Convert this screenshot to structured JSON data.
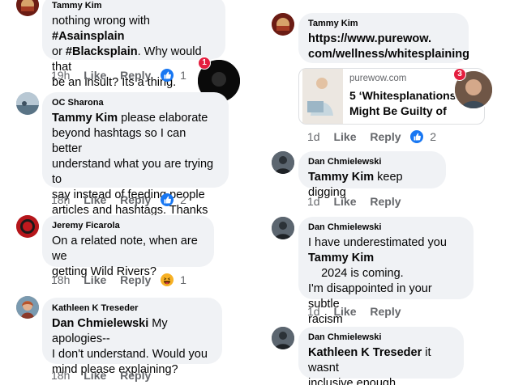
{
  "comments": {
    "c1": {
      "name": "Tammy Kim",
      "line1a": "nothing wrong with ",
      "line1b": "#Asainsplain",
      "line2a": "or ",
      "line2b": "#Blacksplain",
      "line2c": ". Why would that",
      "line3": "be an insult? Its a thing.",
      "time": "19h",
      "like": "Like",
      "reply": "Reply",
      "reaction_count": "1",
      "badge": "1"
    },
    "c2": {
      "name": "OC Sharona",
      "mention": "Tammy Kim",
      "line1": " please elaborate",
      "line2": "beyond hashtags so I can better",
      "line3": "understand what you are trying to",
      "line4": "say instead of feeding people",
      "line5": "articles and hashtags. Thanks",
      "time": "18h",
      "like": "Like",
      "reply": "Reply",
      "reaction_count": "2"
    },
    "c3": {
      "name": "Jeremy Ficarola",
      "line1": "On a related note, when are we",
      "line2": "getting Wild Rivers?",
      "time": "18h",
      "like": "Like",
      "reply": "Reply",
      "reaction_count": "1"
    },
    "c4": {
      "name": "Kathleen K Treseder",
      "mention": "Dan Chmielewski",
      "line1": " My apologies--",
      "line2": "I don't understand. Would you",
      "line3": "mind please explaining?",
      "time": "18h",
      "like": "Like",
      "reply": "Reply"
    },
    "c5": {
      "name": "Tammy Kim",
      "line1": "https://www.purewow.",
      "line2": "com/wellness/whitesplaining",
      "link_domain": "purewow.com",
      "link_title1": "5 ‘Whitesplanations",
      "link_title2": "Might Be Guilty of",
      "time": "1d",
      "like": "Like",
      "reply": "Reply",
      "reaction_count": "2",
      "badge": "3"
    },
    "c6": {
      "name": "Dan Chmielewski",
      "mention": "Tammy Kim",
      "line1": " keep digging",
      "time": "1d",
      "like": "Like",
      "reply": "Reply"
    },
    "c7": {
      "name": "Dan Chmielewski",
      "line1": "I have underestimated you",
      "mention": "Tammy Kim",
      "line2": "    2024 is coming.",
      "line3": "I'm disappointed in your subtle",
      "line4": "racism",
      "time": "1d",
      "like": "Like",
      "reply": "Reply"
    },
    "c8": {
      "name": "Dan Chmielewski",
      "mention": "Kathleen K Treseder",
      "line1": " it wasnt",
      "line2": "inclusive enough"
    }
  },
  "icons": {
    "like": "like-reaction-icon",
    "haha": "haha-reaction-icon"
  }
}
